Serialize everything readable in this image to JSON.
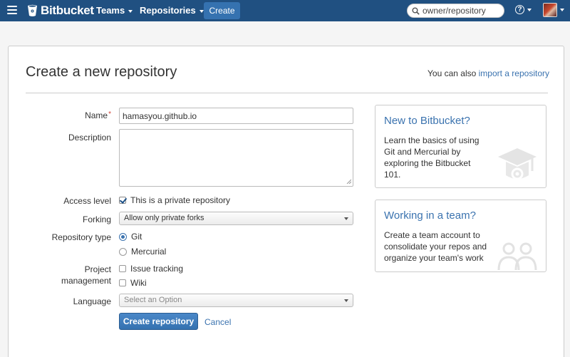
{
  "nav": {
    "brand": "Bitbucket",
    "teams": "Teams",
    "repositories": "Repositories",
    "create": "Create",
    "search_placeholder": "owner/repository",
    "help": "?"
  },
  "page": {
    "title": "Create a new repository",
    "import_prefix": "You can also",
    "import_link": "import a repository"
  },
  "form": {
    "name_label": "Name",
    "name_required_mark": "*",
    "name_value": "hamasyou.github.io",
    "description_label": "Description",
    "description_value": "",
    "access_label": "Access level",
    "private_label": "This is a private repository",
    "private_checked": true,
    "forking_label": "Forking",
    "forking_value": "Allow only private forks",
    "repo_type_label": "Repository type",
    "repo_type_options": [
      {
        "label": "Git",
        "selected": true
      },
      {
        "label": "Mercurial",
        "selected": false
      }
    ],
    "project_label_line1": "Project",
    "project_label_line2": "management",
    "issue_tracking_label": "Issue tracking",
    "wiki_label": "Wiki",
    "language_label": "Language",
    "language_placeholder": "Select an Option",
    "submit_label": "Create repository",
    "cancel_label": "Cancel"
  },
  "sidebar": {
    "new_title": "New to Bitbucket?",
    "new_text": [
      "Learn the basics of using",
      "Git and Mercurial by",
      "exploring the Bitbucket",
      "101."
    ],
    "team_title": "Working in a team?",
    "team_text": [
      "Create a team account to",
      "consolidate your repos and",
      "organize your team's work"
    ]
  },
  "colors": {
    "nav_bg": "#205081",
    "link": "#3b73af",
    "primary_button": "#3572b0",
    "required": "#d04437"
  },
  "icons": {
    "menu": "hamburger-icon",
    "logo": "bitbucket-logo-icon",
    "search": "search-icon",
    "help": "help-icon",
    "grad_cap": "graduation-cap-icon",
    "team": "team-icon"
  }
}
